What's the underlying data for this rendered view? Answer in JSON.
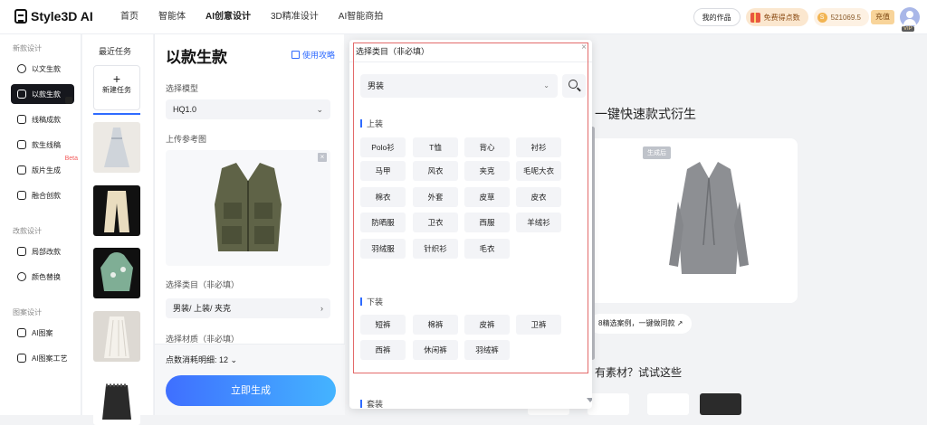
{
  "brand": {
    "name": "Style3D AI"
  },
  "nav": [
    "首页",
    "智能体",
    "AI创意设计",
    "3D精准设计",
    "AI智能商拍"
  ],
  "header": {
    "my_works": "我的作品",
    "free_points": "免费得点数",
    "coin_symbol": "S",
    "balance": "521069.5",
    "recharge": "充值",
    "vip": "VIP"
  },
  "sidebar": {
    "sections": [
      {
        "title": "新款设计",
        "items": [
          "以文生款",
          "以款生款",
          "线稿成款",
          "款生线稿",
          "版片生成",
          "融合创款"
        ]
      },
      {
        "title": "改款设计",
        "items": [
          "局部改款",
          "颜色替换"
        ]
      },
      {
        "title": "图案设计",
        "items": [
          "AI图案",
          "AI图案工艺"
        ]
      }
    ],
    "beta": "Beta"
  },
  "tasks": {
    "title": "最近任务",
    "new_task": "新建任务",
    "plus": "+"
  },
  "form": {
    "title": "以款生款",
    "guide": "使用攻略",
    "model_label": "选择模型",
    "model_value": "HQ1.0",
    "upload_label": "上传参考图",
    "category_label": "选择类目（非必填）",
    "category_value": "男装/ 上装/ 夹克",
    "material_label": "选择材质（非必填）",
    "cost": "点数消耗明细: 12",
    "generate": "立即生成"
  },
  "main": {
    "heading": "一键快速款式衍生",
    "after_tag": "生成后",
    "case_link": "8精选案例，一键做同款",
    "empty_hint": "有素材？试试这些"
  },
  "modal": {
    "title": "选择类目（非必填）",
    "close": "×",
    "select_value": "男装",
    "groups": [
      {
        "name": "上装",
        "chips": [
          "Polo衫",
          "T恤",
          "背心",
          "衬衫",
          "马甲",
          "风衣",
          "夹克",
          "毛呢大衣",
          "棉衣",
          "外套",
          "皮草",
          "皮衣",
          "防晒服",
          "卫衣",
          "西服",
          "羊绒衫",
          "羽绒服",
          "针织衫",
          "毛衣"
        ]
      },
      {
        "name": "下装",
        "chips": [
          "短裤",
          "棉裤",
          "皮裤",
          "卫裤",
          "西裤",
          "休闲裤",
          "羽绒裤"
        ]
      },
      {
        "name": "套装",
        "chips": []
      }
    ]
  }
}
